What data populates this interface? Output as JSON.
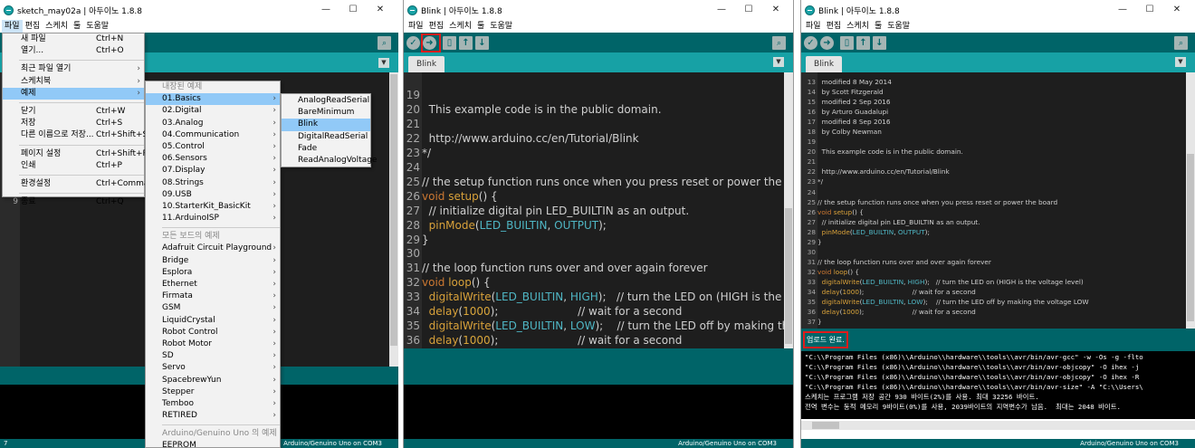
{
  "window1": {
    "title": "sketch_may02a | 아두이노 1.8.8",
    "menubar": [
      "파일",
      "편집",
      "스케치",
      "툴",
      "도움말"
    ],
    "file_menu": [
      {
        "label": "새 파일",
        "shortcut": "Ctrl+N"
      },
      {
        "label": "열기...",
        "shortcut": "Ctrl+O"
      },
      {
        "label": "최근 파일 열기",
        "arrow": "›"
      },
      {
        "label": "스케치북",
        "arrow": "›"
      },
      {
        "label": "예제",
        "arrow": "›",
        "highlight": true
      },
      {
        "label": "닫기",
        "shortcut": "Ctrl+W"
      },
      {
        "label": "저장",
        "shortcut": "Ctrl+S"
      },
      {
        "label": "다른 이름으로 저장...",
        "shortcut": "Ctrl+Shift+S"
      },
      {
        "label": "페이지 설정",
        "shortcut": "Ctrl+Shift+P"
      },
      {
        "label": "인쇄",
        "shortcut": "Ctrl+P"
      },
      {
        "label": "환경설정",
        "shortcut": "Ctrl+Comma"
      },
      {
        "label": "종료",
        "shortcut": "Ctrl+Q"
      }
    ],
    "examples_menu": {
      "builtin_header": "내장된 예제",
      "builtin": [
        "01.Basics",
        "02.Digital",
        "03.Analog",
        "04.Communication",
        "05.Control",
        "06.Sensors",
        "07.Display",
        "08.Strings",
        "09.USB",
        "10.StarterKit_BasicKit",
        "11.ArduinoISP"
      ],
      "all_boards_header": "모든 보드의 예제",
      "all_boards": [
        "Adafruit Circuit Playground",
        "Bridge",
        "Esplora",
        "Ethernet",
        "Firmata",
        "GSM",
        "LiquidCrystal",
        "Robot Control",
        "Robot Motor",
        "SD",
        "Servo",
        "SpacebrewYun",
        "Stepper",
        "Temboo",
        "RETIRED"
      ],
      "uno_header": "Arduino/Genuino Uno 의 예제",
      "uno_partial": "EEPROM"
    },
    "basics_menu": [
      "AnalogReadSerial",
      "BareMinimum",
      "Blink",
      "DigitalReadSerial",
      "Fade",
      "ReadAnalogVoltage"
    ],
    "editor_visible_line": "9",
    "status_left": "7",
    "board": "Arduino/Genuino Uno on COM3"
  },
  "window2": {
    "title": "Blink | 아두이노 1.8.8",
    "menubar": [
      "파일",
      "편집",
      "스케치",
      "툴",
      "도움말"
    ],
    "tab": "Blink",
    "board": "Arduino/Genuino Uno on COM3",
    "code_lines": [
      {
        "n": "19",
        "segs": [
          [
            "c",
            ""
          ]
        ]
      },
      {
        "n": "20",
        "segs": [
          [
            "c",
            "  This example code is in the public domain."
          ]
        ]
      },
      {
        "n": "21",
        "segs": [
          [
            "c",
            ""
          ]
        ]
      },
      {
        "n": "22",
        "segs": [
          [
            "c",
            "  http://www.arduino.cc/en/Tutorial/Blink"
          ]
        ]
      },
      {
        "n": "23",
        "segs": [
          [
            "c",
            "*/"
          ]
        ]
      },
      {
        "n": "24",
        "segs": [
          [
            "c",
            ""
          ]
        ]
      },
      {
        "n": "25",
        "segs": [
          [
            "c",
            "// the setup function runs once when you press reset or power the board"
          ]
        ]
      },
      {
        "n": "26",
        "segs": [
          [
            "kw",
            "void "
          ],
          [
            "fn",
            "setup"
          ],
          [
            "c",
            "() {"
          ]
        ]
      },
      {
        "n": "27",
        "segs": [
          [
            "c",
            "  // initialize digital pin LED_BUILTIN as an output."
          ]
        ]
      },
      {
        "n": "28",
        "segs": [
          [
            "fn",
            "  pinMode"
          ],
          [
            "c",
            "("
          ],
          [
            "cst",
            "LED_BUILTIN"
          ],
          [
            "c",
            ", "
          ],
          [
            "cst",
            "OUTPUT"
          ],
          [
            "c",
            ");"
          ]
        ]
      },
      {
        "n": "29",
        "segs": [
          [
            "c",
            "}"
          ]
        ]
      },
      {
        "n": "30",
        "segs": [
          [
            "c",
            ""
          ]
        ]
      },
      {
        "n": "31",
        "segs": [
          [
            "c",
            "// the loop function runs over and over again forever"
          ]
        ]
      },
      {
        "n": "32",
        "segs": [
          [
            "kw",
            "void "
          ],
          [
            "fn",
            "loop"
          ],
          [
            "c",
            "() {"
          ]
        ]
      },
      {
        "n": "33",
        "segs": [
          [
            "fn",
            "  digitalWrite"
          ],
          [
            "c",
            "("
          ],
          [
            "cst",
            "LED_BUILTIN"
          ],
          [
            "c",
            ", "
          ],
          [
            "cst",
            "HIGH"
          ],
          [
            "c",
            ");   // turn the LED on (HIGH is the voltage level)"
          ]
        ]
      },
      {
        "n": "34",
        "segs": [
          [
            "fn",
            "  delay"
          ],
          [
            "c",
            "("
          ],
          [
            "num",
            "1000"
          ],
          [
            "c",
            ");                       // wait for a second"
          ]
        ]
      },
      {
        "n": "35",
        "segs": [
          [
            "fn",
            "  digitalWrite"
          ],
          [
            "c",
            "("
          ],
          [
            "cst",
            "LED_BUILTIN"
          ],
          [
            "c",
            ", "
          ],
          [
            "cst",
            "LOW"
          ],
          [
            "c",
            ");    // turn the LED off by making the voltage LOW"
          ]
        ]
      },
      {
        "n": "36",
        "segs": [
          [
            "fn",
            "  delay"
          ],
          [
            "c",
            "("
          ],
          [
            "num",
            "1000"
          ],
          [
            "c",
            ");                       // wait for a second"
          ]
        ]
      },
      {
        "n": "37",
        "segs": [
          [
            "c",
            "}"
          ]
        ]
      }
    ]
  },
  "window3": {
    "title": "Blink | 아두이노 1.8.8",
    "menubar": [
      "파일",
      "편집",
      "스케치",
      "툴",
      "도움말"
    ],
    "tab": "Blink",
    "board": "Arduino/Genuino Uno on COM3",
    "status_message": "업로드 완료.",
    "code_lines": [
      {
        "n": "13",
        "segs": [
          [
            "c",
            "  modified 8 May 2014"
          ]
        ]
      },
      {
        "n": "14",
        "segs": [
          [
            "c",
            "  by Scott Fitzgerald"
          ]
        ]
      },
      {
        "n": "15",
        "segs": [
          [
            "c",
            "  modified 2 Sep 2016"
          ]
        ]
      },
      {
        "n": "16",
        "segs": [
          [
            "c",
            "  by Arturo Guadalupi"
          ]
        ]
      },
      {
        "n": "17",
        "segs": [
          [
            "c",
            "  modified 8 Sep 2016"
          ]
        ]
      },
      {
        "n": "18",
        "segs": [
          [
            "c",
            "  by Colby Newman"
          ]
        ]
      },
      {
        "n": "19",
        "segs": [
          [
            "c",
            ""
          ]
        ]
      },
      {
        "n": "20",
        "segs": [
          [
            "c",
            "  This example code is in the public domain."
          ]
        ]
      },
      {
        "n": "21",
        "segs": [
          [
            "c",
            ""
          ]
        ]
      },
      {
        "n": "22",
        "segs": [
          [
            "c",
            "  http://www.arduino.cc/en/Tutorial/Blink"
          ]
        ]
      },
      {
        "n": "23",
        "segs": [
          [
            "c",
            "*/"
          ]
        ]
      },
      {
        "n": "24",
        "segs": [
          [
            "c",
            ""
          ]
        ]
      },
      {
        "n": "25",
        "segs": [
          [
            "c",
            "// the setup function runs once when you press reset or power the board"
          ]
        ]
      },
      {
        "n": "26",
        "segs": [
          [
            "kw",
            "void "
          ],
          [
            "fn",
            "setup"
          ],
          [
            "c",
            "() {"
          ]
        ]
      },
      {
        "n": "27",
        "segs": [
          [
            "c",
            "  // initialize digital pin LED_BUILTIN as an output."
          ]
        ]
      },
      {
        "n": "28",
        "segs": [
          [
            "fn",
            "  pinMode"
          ],
          [
            "c",
            "("
          ],
          [
            "cst",
            "LED_BUILTIN"
          ],
          [
            "c",
            ", "
          ],
          [
            "cst",
            "OUTPUT"
          ],
          [
            "c",
            ");"
          ]
        ]
      },
      {
        "n": "29",
        "segs": [
          [
            "c",
            "}"
          ]
        ]
      },
      {
        "n": "30",
        "segs": [
          [
            "c",
            ""
          ]
        ]
      },
      {
        "n": "31",
        "segs": [
          [
            "c",
            "// the loop function runs over and over again forever"
          ]
        ]
      },
      {
        "n": "32",
        "segs": [
          [
            "kw",
            "void "
          ],
          [
            "fn",
            "loop"
          ],
          [
            "c",
            "() {"
          ]
        ]
      },
      {
        "n": "33",
        "segs": [
          [
            "fn",
            "  digitalWrite"
          ],
          [
            "c",
            "("
          ],
          [
            "cst",
            "LED_BUILTIN"
          ],
          [
            "c",
            ", "
          ],
          [
            "cst",
            "HIGH"
          ],
          [
            "c",
            ");   // turn the LED on (HIGH is the voltage level)"
          ]
        ]
      },
      {
        "n": "34",
        "segs": [
          [
            "fn",
            "  delay"
          ],
          [
            "c",
            "("
          ],
          [
            "num",
            "1000"
          ],
          [
            "c",
            ");                       // wait for a second"
          ]
        ]
      },
      {
        "n": "35",
        "segs": [
          [
            "fn",
            "  digitalWrite"
          ],
          [
            "c",
            "("
          ],
          [
            "cst",
            "LED_BUILTIN"
          ],
          [
            "c",
            ", "
          ],
          [
            "cst",
            "LOW"
          ],
          [
            "c",
            ");    // turn the LED off by making the voltage LOW"
          ]
        ]
      },
      {
        "n": "36",
        "segs": [
          [
            "fn",
            "  delay"
          ],
          [
            "c",
            "("
          ],
          [
            "num",
            "1000"
          ],
          [
            "c",
            ");                       // wait for a second"
          ]
        ]
      },
      {
        "n": "37",
        "segs": [
          [
            "c",
            "}"
          ]
        ]
      }
    ],
    "console_lines": [
      "\"C:\\\\Program Files (x86)\\\\Arduino\\\\hardware\\\\tools\\\\avr/bin/avr-gcc\" -w -Os -g -flto",
      "\"C:\\\\Program Files (x86)\\\\Arduino\\\\hardware\\\\tools\\\\avr/bin/avr-objcopy\" -O ihex -j",
      "\"C:\\\\Program Files (x86)\\\\Arduino\\\\hardware\\\\tools\\\\avr/bin/avr-objcopy\" -O ihex -R",
      "\"C:\\\\Program Files (x86)\\\\Arduino\\\\hardware\\\\tools\\\\avr/bin/avr-size\" -A \"C:\\\\Users\\",
      "스케치는 프로그램 저장 공간 930 바이트(2%)를 사용. 최대 32256 바이트.",
      "전역 변수는 동적 메모리 9바이트(0%)를 사용, 2039바이트의 지역변수가 남음.  최대는 2048 바이트."
    ]
  },
  "icons": {
    "verify": "✓",
    "upload": "➜",
    "new": "▯",
    "open": "↑",
    "save": "↓",
    "serial": "⌕",
    "tab_menu": "▼",
    "minimize": "—",
    "maximize": "☐",
    "close": "✕",
    "submenu_arrow": "›"
  },
  "colors": {
    "toolbar": "#006468",
    "tabbar": "#17a1a5",
    "editor_bg": "#1e1e1e",
    "highlight_box": "#e21b1b",
    "menu_highlight": "#91c9f7"
  }
}
